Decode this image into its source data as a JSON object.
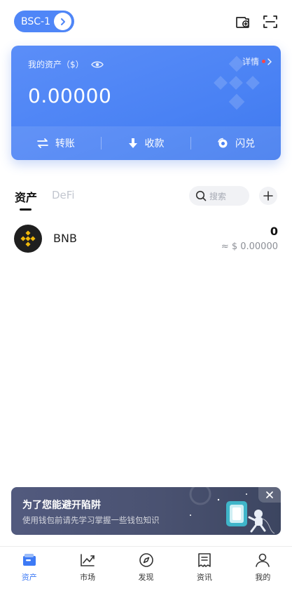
{
  "header": {
    "network": "BSC-1"
  },
  "asset_card": {
    "label": "我的资产（$）",
    "details_label": "详情",
    "balance": "0.00000",
    "actions": {
      "transfer": "转账",
      "receive": "收款",
      "swap": "闪兑"
    }
  },
  "tabs": {
    "assets": "资产",
    "defi": "DeFi",
    "search_placeholder": "搜索"
  },
  "tokens": [
    {
      "symbol": "BNB",
      "amount": "0",
      "value": "≈ $ 0.00000"
    }
  ],
  "banner": {
    "title": "为了您能避开陷阱",
    "subtitle": "使用钱包前请先学习掌握一些钱包知识"
  },
  "bottom_nav": [
    {
      "label": "资产",
      "icon": "wallet-icon",
      "active": true
    },
    {
      "label": "市场",
      "icon": "chart-icon",
      "active": false
    },
    {
      "label": "发现",
      "icon": "compass-icon",
      "active": false
    },
    {
      "label": "资讯",
      "icon": "news-icon",
      "active": false
    },
    {
      "label": "我的",
      "icon": "profile-icon",
      "active": false
    }
  ],
  "colors": {
    "accent": "#4a82f4",
    "nav_active": "#3d7af5",
    "notification_dot": "#ff4545",
    "banner_bg": "#4a5271"
  }
}
